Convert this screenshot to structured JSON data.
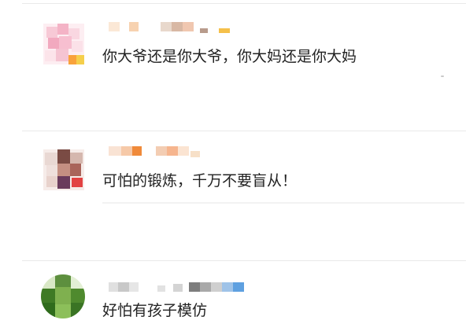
{
  "comments": [
    {
      "text": "你大爷还是你大爷，你大妈还是你大妈"
    },
    {
      "text": "可怕的锻炼，千万不要盲从！"
    },
    {
      "text": "好怕有孩子模仿"
    }
  ],
  "colors": {
    "text": "#222222",
    "divider": "#e9e9e9"
  },
  "icons": {
    "avatar": "avatar-icon",
    "username": "blurred-username"
  }
}
